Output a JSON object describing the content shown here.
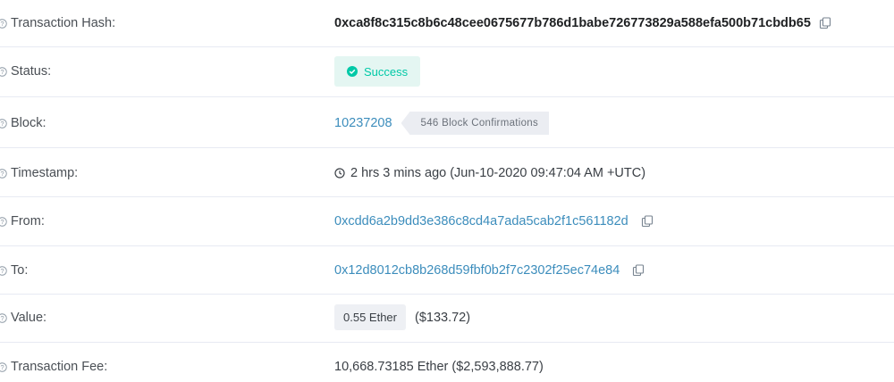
{
  "rows": {
    "hash": {
      "label": "Transaction Hash:",
      "value": "0xca8f8c315c8b6c48cee0675677b786d1babe726773829a588efa500b71cbdb65"
    },
    "status": {
      "label": "Status:",
      "value": "Success"
    },
    "block": {
      "label": "Block:",
      "number": "10237208",
      "confirmations": "546 Block Confirmations"
    },
    "timestamp": {
      "label": "Timestamp:",
      "value": "2 hrs 3 mins ago (Jun-10-2020 09:47:04 AM +UTC)"
    },
    "from": {
      "label": "From:",
      "value": "0xcdd6a2b9dd3e386c8cd4a7ada5cab2f1c561182d"
    },
    "to": {
      "label": "To:",
      "value": "0x12d8012cb8b268d59fbf0b2f7c2302f25ec74e84"
    },
    "value": {
      "label": "Value:",
      "ether": "0.55 Ether",
      "usd": "($133.72)"
    },
    "fee": {
      "label": "Transaction Fee:",
      "value": "10,668.73185 Ether ($2,593,888.77)"
    }
  },
  "colors": {
    "link": "#3c8dbc",
    "success_text": "#00c9a7",
    "success_bg": "#e4f6f2",
    "divider": "#e7eaf3"
  },
  "icons": {
    "help": "question-circle-icon",
    "copy": "copy-icon",
    "check": "check-circle-icon",
    "clock": "clock-icon"
  }
}
